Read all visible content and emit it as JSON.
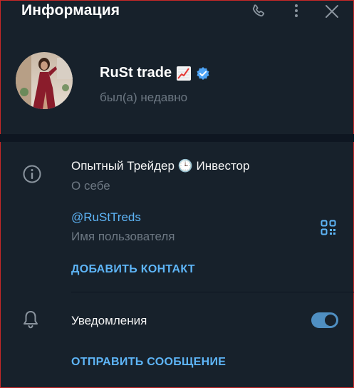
{
  "header": {
    "title": "Информация",
    "icons": [
      "phone-icon",
      "more-icon",
      "close-icon"
    ]
  },
  "profile": {
    "name": "RuSt trade",
    "status": "был(а) недавно",
    "verified": true
  },
  "info": {
    "bio": "Опытный Трейдер 🕒 Инвестор",
    "bio_label": "О себе",
    "username": "@RuStTreds",
    "username_label": "Имя пользователя",
    "add_contact": "ДОБАВИТЬ КОНТАКТ"
  },
  "notifications": {
    "label": "Уведомления",
    "enabled": true
  },
  "actions": {
    "send_message": "ОТПРАВИТЬ СООБЩЕНИЕ"
  },
  "colors": {
    "background": "#17212b",
    "separator": "#0e1621",
    "accent": "#5eb5f7",
    "muted": "#6d7883",
    "toggle": "#4f8fc2"
  }
}
